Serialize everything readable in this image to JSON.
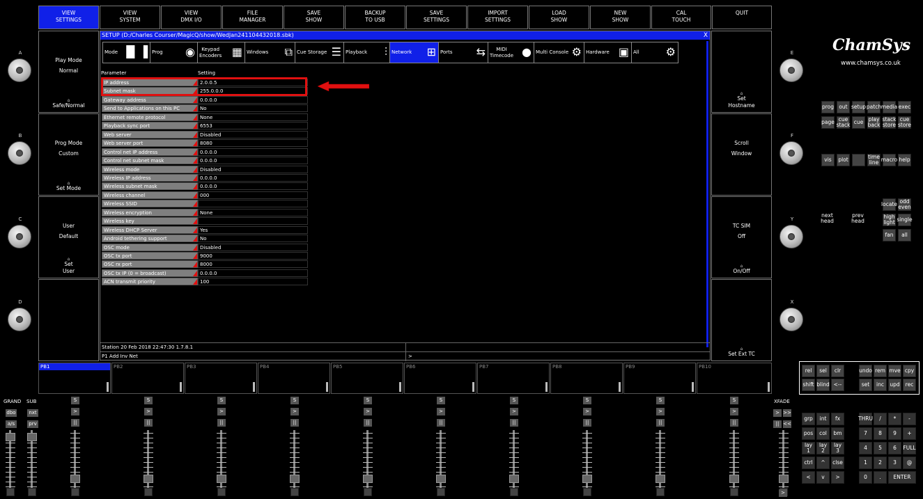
{
  "top_buttons": [
    {
      "label": "VIEW\nSETTINGS",
      "active": true
    },
    {
      "label": "VIEW\nSYSTEM",
      "active": false
    },
    {
      "label": "VIEW\nDMX I/O",
      "active": false
    },
    {
      "label": "FILE\nMANAGER",
      "active": false
    },
    {
      "label": "SAVE\nSHOW",
      "active": false
    },
    {
      "label": "BACKUP\nTO USB",
      "active": false
    },
    {
      "label": "SAVE\nSETTINGS",
      "active": false
    },
    {
      "label": "IMPORT\nSETTINGS",
      "active": false
    },
    {
      "label": "LOAD\nSHOW",
      "active": false
    },
    {
      "label": "NEW\nSHOW",
      "active": false
    },
    {
      "label": "CAL\nTOUCH",
      "active": false
    },
    {
      "label": "QUIT",
      "active": false
    }
  ],
  "left_softkeys": [
    {
      "top": "Play Mode\nNormal",
      "bottom": "Safe/Normal"
    },
    {
      "top": "Prog Mode\nCustom",
      "bottom": "Set Mode"
    },
    {
      "top": "User\nDefault",
      "bottom": "Set\nUser"
    },
    {
      "top": "",
      "bottom": ""
    }
  ],
  "right_softkeys": [
    {
      "top": "",
      "bottom": "Set\nHostname"
    },
    {
      "top": "Scroll\nWindow",
      "bottom": ""
    },
    {
      "top": "TC SIM\nOff",
      "bottom": "On/Off"
    },
    {
      "top": "",
      "bottom": "Set Ext TC"
    }
  ],
  "encoders_left": [
    "A",
    "B",
    "C",
    "D"
  ],
  "encoders_right": [
    "E",
    "F",
    "Y",
    "X"
  ],
  "window": {
    "title": "SETUP (D:/Charles Courser/MagicQ/show/WedJan241104432018.sbk)",
    "close": "X",
    "tabs": [
      {
        "label": "Mode",
        "icon": "▐▌▐",
        "active": false
      },
      {
        "label": "Prog",
        "icon": "◉",
        "active": false
      },
      {
        "label": "Keypad\nEncoders",
        "icon": "▦",
        "active": false
      },
      {
        "label": "Windows",
        "icon": "⧉",
        "active": false
      },
      {
        "label": "Cue Storage",
        "icon": "☰",
        "active": false
      },
      {
        "label": "Playback",
        "icon": "⫶",
        "active": false
      },
      {
        "label": "Network",
        "icon": "⊞",
        "active": true
      },
      {
        "label": "Ports",
        "icon": "⇆",
        "active": false
      },
      {
        "label": "MIDI\nTimecode",
        "icon": "●",
        "active": false
      },
      {
        "label": "Multi Console",
        "icon": "⚙",
        "active": false
      },
      {
        "label": "Hardware",
        "icon": "▣",
        "active": false
      },
      {
        "label": "All",
        "icon": "⚙",
        "active": false
      }
    ],
    "col_param": "Parameter",
    "col_setting": "Setting",
    "rows": [
      {
        "param": "IP address",
        "value": "2.0.0.5"
      },
      {
        "param": "Subnet mask",
        "value": "255.0.0.0"
      },
      {
        "param": "Gateway address",
        "value": "0.0.0.0"
      },
      {
        "param": "Send to Applications on this PC",
        "value": "No"
      },
      {
        "param": "Ethernet remote protocol",
        "value": "None"
      },
      {
        "param": "Playback sync port",
        "value": "6553"
      },
      {
        "param": "Web server",
        "value": "Disabled"
      },
      {
        "param": "Web server port",
        "value": "8080"
      },
      {
        "param": "Control net IP address",
        "value": "0.0.0.0"
      },
      {
        "param": "Control net subnet mask",
        "value": "0.0.0.0"
      },
      {
        "param": "Wireless mode",
        "value": "Disabled"
      },
      {
        "param": "Wireless IP address",
        "value": "0.0.0.0"
      },
      {
        "param": "Wireless subnet mask",
        "value": "0.0.0.0"
      },
      {
        "param": "Wireless channel",
        "value": "000"
      },
      {
        "param": "Wireless SSID",
        "value": ""
      },
      {
        "param": "Wireless encryption",
        "value": "None"
      },
      {
        "param": "Wireless key",
        "value": ""
      },
      {
        "param": "Wireless DHCP Server",
        "value": "Yes"
      },
      {
        "param": "Android tethering support",
        "value": "No"
      },
      {
        "param": "OSC mode",
        "value": "Disabled"
      },
      {
        "param": "OSC tx port",
        "value": "9000"
      },
      {
        "param": "OSC rx port",
        "value": "8000"
      },
      {
        "param": "OSC tx IP (0 = broadcast)",
        "value": "0.0.0.0"
      },
      {
        "param": "ACN transmit priority",
        "value": "100"
      }
    ],
    "status": "Station 20 Feb 2018 22:47:30 1.7.8.1",
    "command": "P1  Add Inv Net",
    "prompt": ">"
  },
  "brand": {
    "logo": "ChamSys",
    "url": "www.chamsys.co.uk"
  },
  "right_keys_1": [
    [
      "prog",
      "out",
      "setup",
      "patch",
      "media",
      "exec"
    ],
    [
      "page",
      "cue\nstack",
      "cue",
      "play\nback",
      "stack\nstore",
      "cue\nstore"
    ]
  ],
  "right_keys_2": [
    "vis",
    "plot",
    "",
    "time\nline",
    "macro",
    "help"
  ],
  "right_keys_3": [
    {
      "label": "next\nhead"
    },
    {
      "label": "prev\nhead"
    },
    {
      "label": "locate"
    },
    {
      "label": "odd\neven"
    },
    {
      "label": "high\nlight"
    },
    {
      "label": "single"
    },
    {
      "label": "fan"
    },
    {
      "label": "all"
    }
  ],
  "edit_keys": [
    [
      "rel",
      "sel",
      "clr",
      "",
      "undo",
      "rem",
      "mve",
      "cpy"
    ],
    [
      "shift",
      "blind",
      "<--",
      "",
      "set",
      "inc",
      "upd",
      "rec"
    ]
  ],
  "keypad": [
    [
      "grp",
      "int",
      "fx",
      "",
      "THRU",
      "/",
      "*",
      "-"
    ],
    [
      "pos",
      "col",
      "bm",
      "",
      "7",
      "8",
      "9",
      "+"
    ],
    [
      "lay 1",
      "lay 2",
      "lay 3",
      "",
      "4",
      "5",
      "6",
      "FULL"
    ],
    [
      "ctrl",
      "^",
      "clse",
      "",
      "1",
      "2",
      "3",
      "@"
    ],
    [
      "<",
      "v",
      ">",
      "",
      "0",
      ".",
      "ENTER",
      ""
    ]
  ],
  "playbacks": [
    "PB1",
    "PB2",
    "PB3",
    "PB4",
    "PB5",
    "PB6",
    "PB7",
    "PB8",
    "PB9",
    "PB10"
  ],
  "fader_labels": {
    "grand": "GRAND",
    "sub": "SUB",
    "xfade": "XFADE"
  },
  "grand_keys": [
    "dbo",
    "nxt",
    "a/s",
    "prv"
  ],
  "xfade_keys": [
    ">",
    ">>",
    "||",
    "<<"
  ],
  "pb_keys": [
    "S",
    ">",
    "||"
  ],
  "colors": {
    "accent": "#1020e8",
    "highlight_box": "#e01010"
  }
}
